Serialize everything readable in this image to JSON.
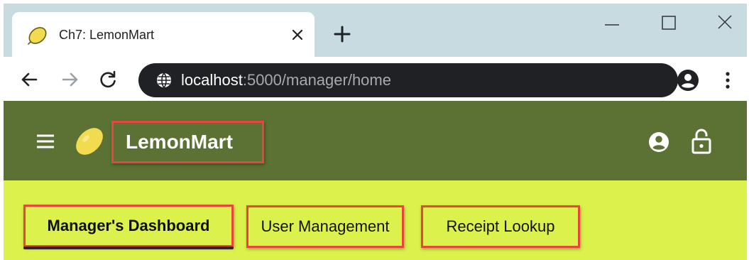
{
  "browser": {
    "tab_title": "Ch7: LemonMart",
    "url_host": "localhost",
    "url_path": ":5000/manager/home"
  },
  "app": {
    "title": "LemonMart"
  },
  "nav": {
    "items": [
      {
        "label": "Manager's Dashboard",
        "active": true
      },
      {
        "label": "User Management",
        "active": false
      },
      {
        "label": "Receipt Lookup",
        "active": false
      }
    ]
  },
  "colors": {
    "tabstrip_bg": "#c7dbe0",
    "omnibox_bg": "#202124",
    "appbar_bg": "#5c7234",
    "navbar_bg": "#dcf14b",
    "highlight_border": "#e8453c",
    "lemon": "#f0dc4e"
  },
  "icons": {
    "favicon": "lemon-icon",
    "tab_close": "close-icon",
    "new_tab": "plus-icon",
    "back": "arrow-left-icon",
    "forward": "arrow-right-icon",
    "reload": "reload-icon",
    "site_info": "globe-icon",
    "profile": "account-circle-icon",
    "browser_menu": "kebab-menu-icon",
    "app_menu": "hamburger-icon",
    "app_logo": "lemon-icon",
    "account": "account-circle-icon",
    "logout": "lock-open-icon"
  }
}
